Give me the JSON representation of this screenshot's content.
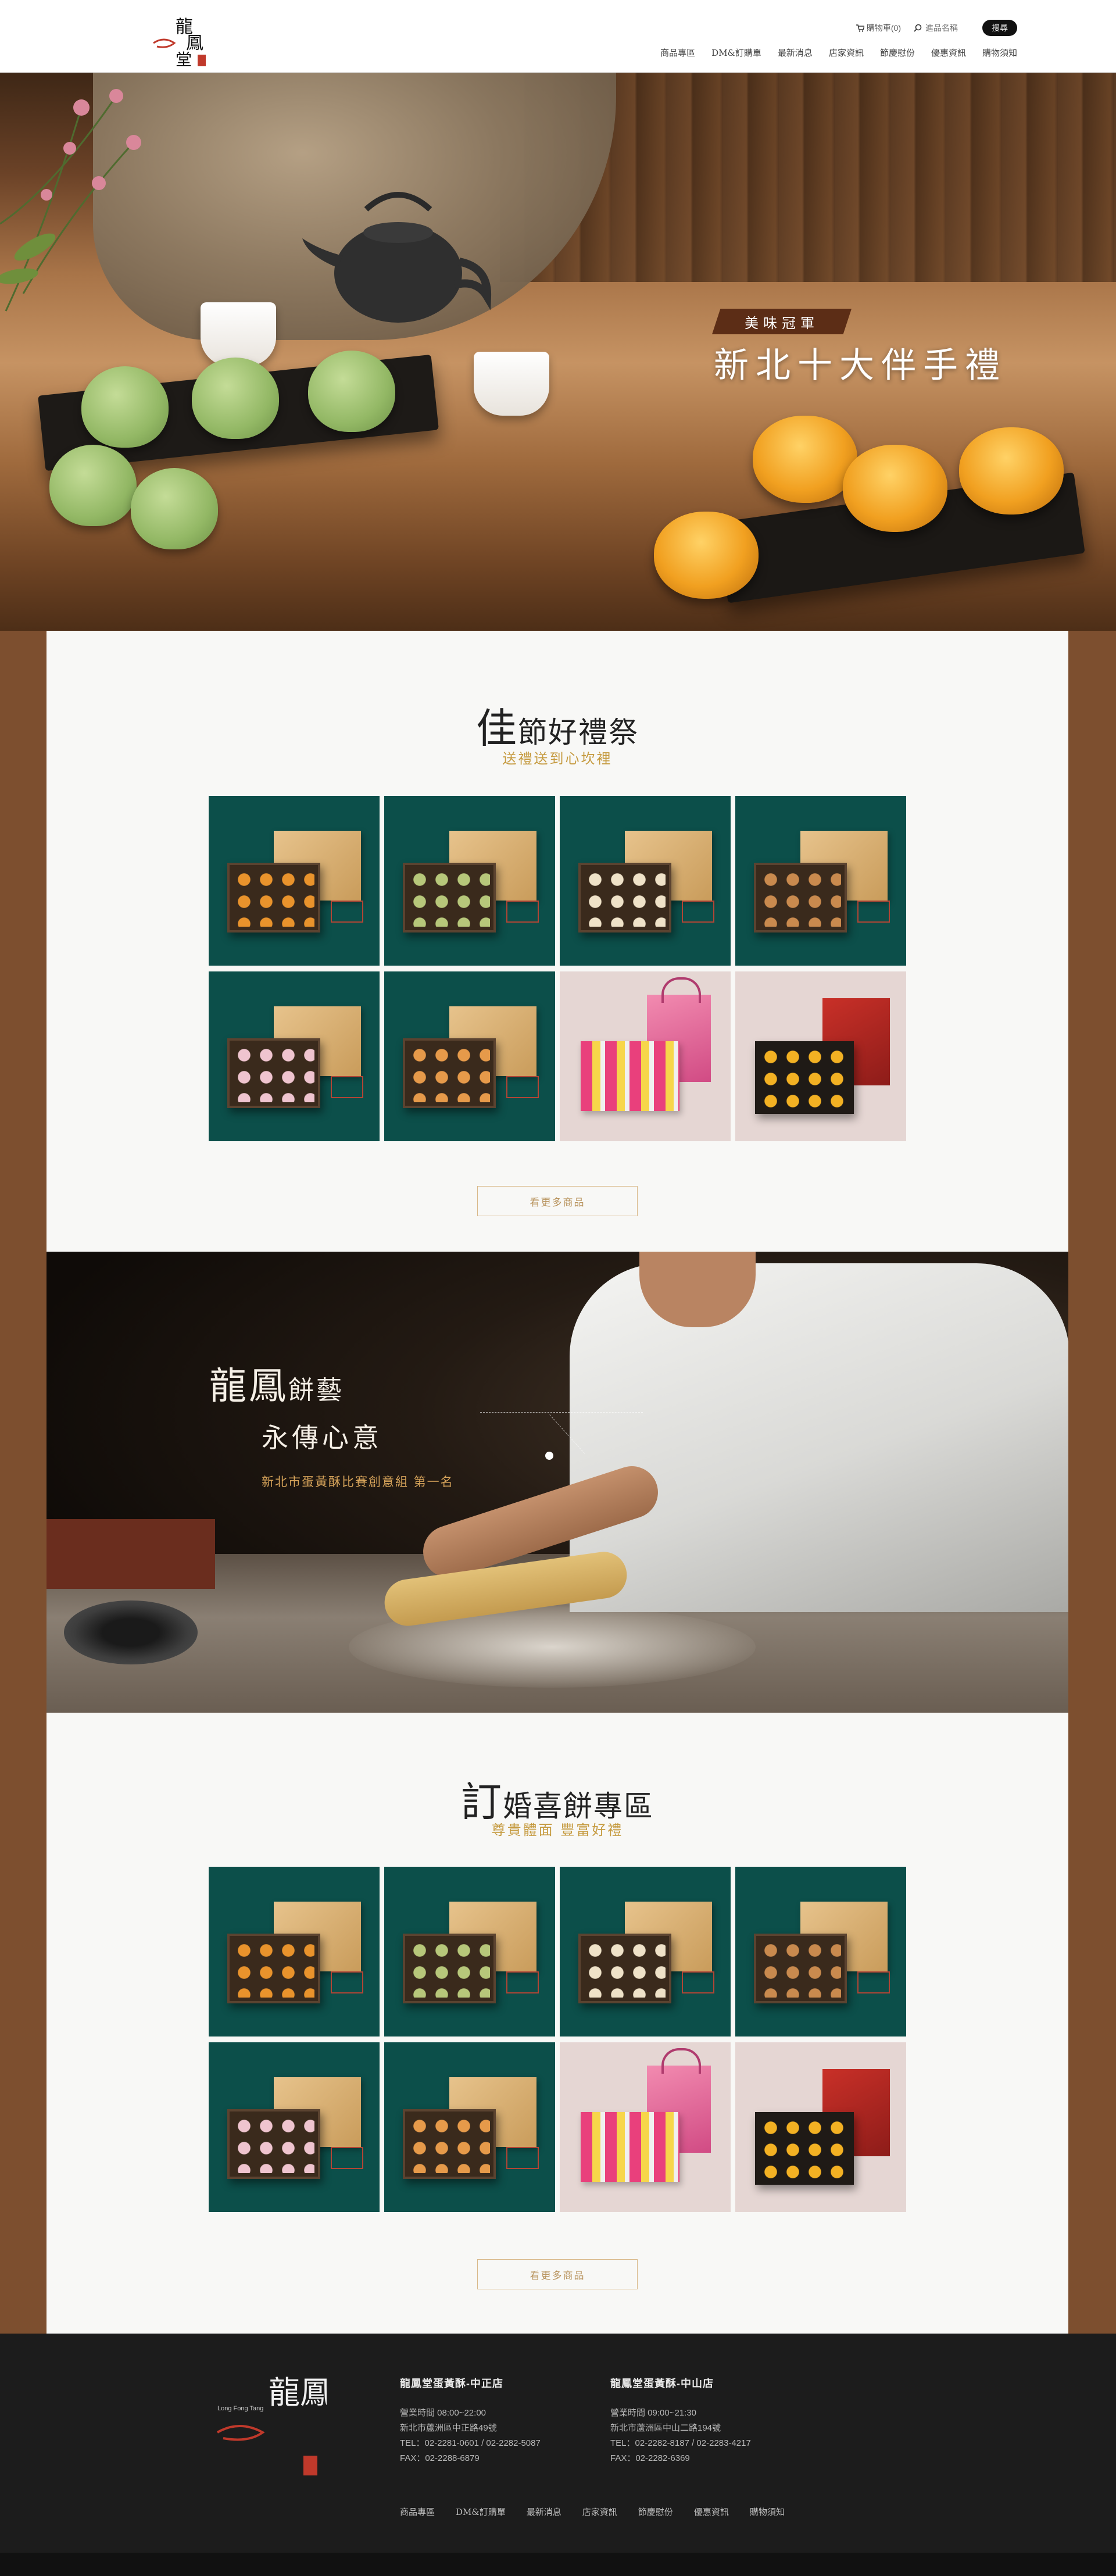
{
  "header": {
    "logo_text": "龍鳳堂",
    "cart_label": "購物車(0)",
    "search_placeholder": "進品名稱",
    "search_button": "搜尋",
    "nav": [
      "商品專區",
      "DM&訂購單",
      "最新消息",
      "店家資訊",
      "節慶慰份",
      "優惠資訊",
      "購物須知"
    ]
  },
  "hero": {
    "badge": "美味冠軍",
    "title": "新北十大伴手禮"
  },
  "section1": {
    "title_big": "佳",
    "title_rest": "節好禮祭",
    "subtitle": "送禮送到心坎裡",
    "more_button": "看更多商品",
    "products": [
      {
        "style": "green",
        "filling": "#e9932c"
      },
      {
        "style": "green",
        "filling": "#b7c77a"
      },
      {
        "style": "green",
        "filling": "#efe2c8"
      },
      {
        "style": "green",
        "filling": "#c98a4e"
      },
      {
        "style": "green",
        "filling": "#efc4cf"
      },
      {
        "style": "green",
        "filling": "#e69a4a"
      },
      {
        "style": "pink-bag",
        "filling": "#e9407c"
      },
      {
        "style": "pink-red",
        "filling": "#f3b123"
      }
    ]
  },
  "baker": {
    "line1_big": "龍鳳",
    "line1_rest": "餅藝",
    "line2": "永傳心意",
    "line3": "新北市蛋黃酥比賽創意組 第一名"
  },
  "section2": {
    "title_big": "訂",
    "title_rest": "婚喜餅專區",
    "subtitle": "尊貴體面 豐富好禮",
    "more_button": "看更多商品",
    "products": [
      {
        "style": "green",
        "filling": "#e9932c"
      },
      {
        "style": "green",
        "filling": "#b7c77a"
      },
      {
        "style": "green",
        "filling": "#efe2c8"
      },
      {
        "style": "green",
        "filling": "#c98a4e"
      },
      {
        "style": "green",
        "filling": "#efc4cf"
      },
      {
        "style": "green",
        "filling": "#e69a4a"
      },
      {
        "style": "pink-bag",
        "filling": "#e9407c"
      },
      {
        "style": "pink-red",
        "filling": "#f3b123"
      }
    ]
  },
  "footer": {
    "logo_text": "龍鳳堂",
    "logo_en": "Long Fong Tang",
    "store1": {
      "title": "龍鳳堂蛋黃酥-中正店",
      "hours": "營業時間   08:00~22:00",
      "address": "新北市蘆洲區中正路49號",
      "tel": "TEL：02-2281-0601 / 02-2282-5087",
      "fax": "FAX：02-2288-6879"
    },
    "store2": {
      "title": "龍鳳堂蛋黃酥-中山店",
      "hours": "營業時間   09:00~21:30",
      "address": "新北市蘆洲區中山二路194號",
      "tel": "TEL：02-2282-8187 / 02-2283-4217",
      "fax": "FAX：02-2282-6369"
    },
    "nav": [
      "商品專區",
      "DM&訂購單",
      "最新消息",
      "店家資訊",
      "節慶慰份",
      "優惠資訊",
      "購物須知"
    ]
  },
  "colors": {
    "brown_bg": "#7d4f2f",
    "product_green": "#0c4f4a",
    "product_pink": "#e5d6d3",
    "accent_gold": "#c59a3f",
    "footer_bg": "#1c1c1c"
  }
}
